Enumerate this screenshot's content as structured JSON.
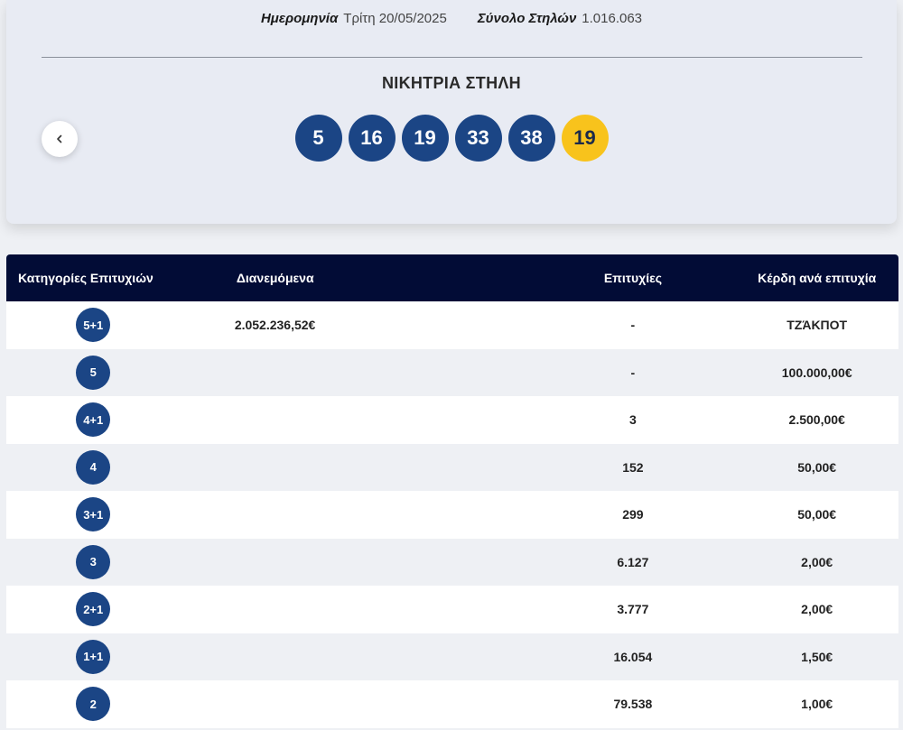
{
  "header": {
    "date_label": "Ημερομηνία",
    "date_value": "Τρίτη 20/05/2025",
    "total_label": "Σύνολο Στηλών",
    "total_value": "1.016.063",
    "winning_title": "ΝΙΚΗΤΡΙΑ ΣΤΗΛΗ",
    "back_icon": "chevron-left-icon"
  },
  "winning_numbers": [
    "5",
    "16",
    "19",
    "33",
    "38"
  ],
  "bonus_number": "19",
  "colors": {
    "ball": "#1b4585",
    "bonus_ball": "#f8c31c",
    "table_header": "#020c36"
  },
  "table": {
    "columns": [
      "Κατηγορίες Επιτυχιών",
      "Διανεμόμενα",
      "Επιτυχίες",
      "Κέρδη ανά επιτυχία"
    ],
    "rows": [
      {
        "category": "5+1",
        "distributed": "2.052.236,52€",
        "winners": "-",
        "prize": "ΤΖΆΚΠΟΤ"
      },
      {
        "category": "5",
        "distributed": "",
        "winners": "-",
        "prize": "100.000,00€"
      },
      {
        "category": "4+1",
        "distributed": "",
        "winners": "3",
        "prize": "2.500,00€"
      },
      {
        "category": "4",
        "distributed": "",
        "winners": "152",
        "prize": "50,00€"
      },
      {
        "category": "3+1",
        "distributed": "",
        "winners": "299",
        "prize": "50,00€"
      },
      {
        "category": "3",
        "distributed": "",
        "winners": "6.127",
        "prize": "2,00€"
      },
      {
        "category": "2+1",
        "distributed": "",
        "winners": "3.777",
        "prize": "2,00€"
      },
      {
        "category": "1+1",
        "distributed": "",
        "winners": "16.054",
        "prize": "1,50€"
      },
      {
        "category": "2",
        "distributed": "",
        "winners": "79.538",
        "prize": "1,00€"
      }
    ]
  }
}
